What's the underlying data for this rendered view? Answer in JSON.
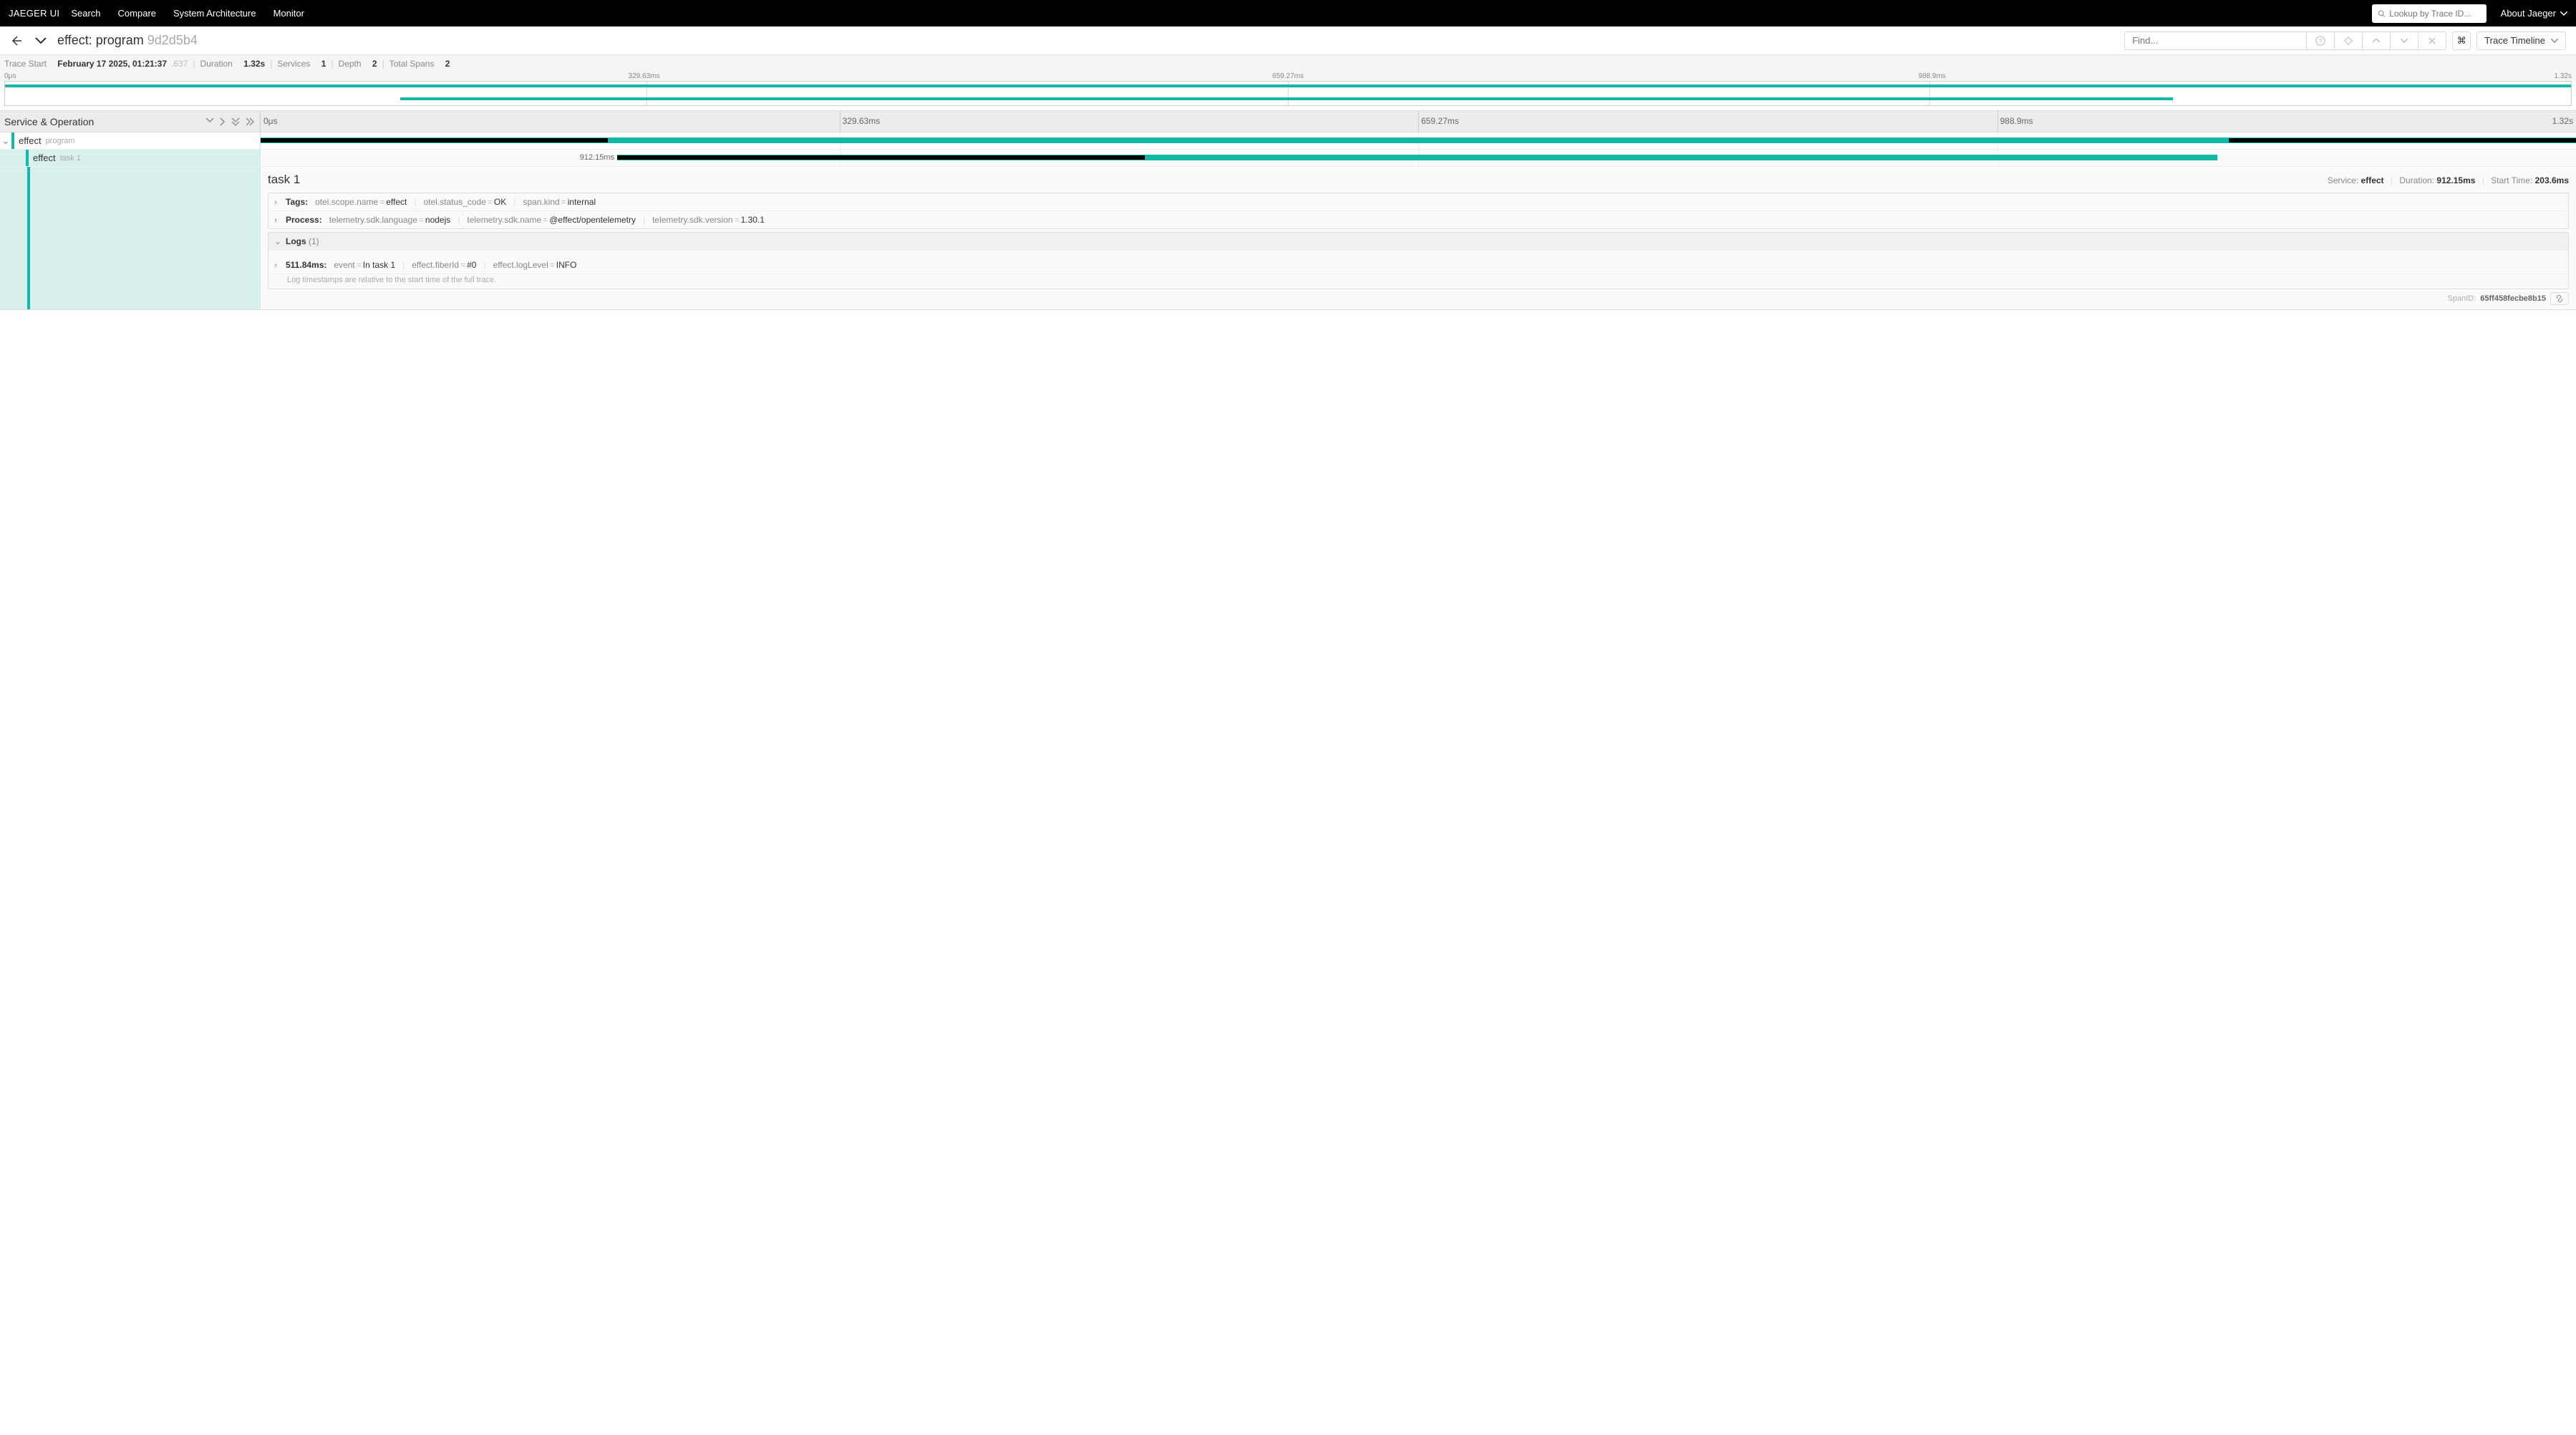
{
  "topbar": {
    "brand": "JAEGER UI",
    "nav": [
      "Search",
      "Compare",
      "System Architecture",
      "Monitor"
    ],
    "lookup_placeholder": "Lookup by Trace ID...",
    "about": "About Jaeger"
  },
  "header": {
    "service": "effect:",
    "operation": "program",
    "hash": "9d2d5b4",
    "find_placeholder": "Find...",
    "kbd": "⌘",
    "view": "Trace Timeline"
  },
  "meta": {
    "start_label": "Trace Start",
    "start_value": "February 17 2025, 01:21:37",
    "start_ms": ".637",
    "duration_label": "Duration",
    "duration_value": "1.32s",
    "services_label": "Services",
    "services_value": "1",
    "depth_label": "Depth",
    "depth_value": "2",
    "spans_label": "Total Spans",
    "spans_value": "2"
  },
  "timeline_ticks": [
    "0μs",
    "329.63ms",
    "659.27ms",
    "988.9ms",
    "1.32s"
  ],
  "cols": {
    "title": "Service & Operation",
    "ticks": [
      "0μs",
      "329.63ms",
      "659.27ms",
      "988.9ms",
      "1.32s"
    ]
  },
  "spans": [
    {
      "service": "effect",
      "operation": "program",
      "start_pct": 0,
      "width_pct": 100,
      "inner_start": 0,
      "inner_width": 15
    },
    {
      "service": "effect",
      "operation": "task 1",
      "start_pct": 15.4,
      "width_pct": 69.1,
      "label": "912.15ms",
      "inner_start": 0,
      "inner_width": 33
    }
  ],
  "detail": {
    "name": "task 1",
    "service_label": "Service:",
    "service": "effect",
    "duration_label": "Duration:",
    "duration": "912.15ms",
    "start_label": "Start Time:",
    "start": "203.6ms",
    "tags_label": "Tags:",
    "tags": [
      {
        "k": "otel.scope.name",
        "v": "effect"
      },
      {
        "k": "otel.status_code",
        "v": "OK"
      },
      {
        "k": "span.kind",
        "v": "internal"
      }
    ],
    "process_label": "Process:",
    "process": [
      {
        "k": "telemetry.sdk.language",
        "v": "nodejs"
      },
      {
        "k": "telemetry.sdk.name",
        "v": "@effect/opentelemetry"
      },
      {
        "k": "telemetry.sdk.version",
        "v": "1.30.1"
      }
    ],
    "logs_label": "Logs",
    "logs_count": "(1)",
    "log_time": "511.84ms:",
    "log_entries": [
      {
        "k": "event",
        "v": "In task 1"
      },
      {
        "k": "effect.fiberId",
        "v": "#0"
      },
      {
        "k": "effect.logLevel",
        "v": "INFO"
      }
    ],
    "log_note": "Log timestamps are relative to the start time of the full trace.",
    "spanid_label": "SpanID:",
    "spanid": "65ff458fecbe8b15"
  }
}
